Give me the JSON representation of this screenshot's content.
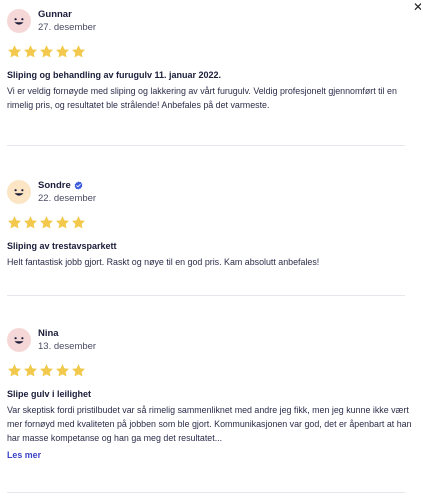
{
  "colors": {
    "star": "#f2c94c",
    "avatar_bg": "#f6d7d7",
    "avatar_bg_2": "#fbe5c5",
    "link": "#3b43c7",
    "verified": "#3b5bdb"
  },
  "close_icon": "close-icon",
  "reviews": [
    {
      "name": "Gunnar",
      "date": "27. desember",
      "rating": 5,
      "verified": false,
      "title": "Sliping og behandling av furugulv 11. januar 2022.",
      "text": "Vi er veldig fornøyde med sliping og lakkering av vårt furugulv. Veldig profesjonelt gjennomført til en rimelig pris, og resultatet ble strålende! Anbefales på det varmeste."
    },
    {
      "name": "Sondre",
      "date": "22. desember",
      "rating": 5,
      "verified": true,
      "title": "Sliping av trestavsparkett",
      "text": "Helt fantastisk jobb gjort. Raskt og nøye til en god pris. Kam absolutt anbefales!"
    },
    {
      "name": "Nina",
      "date": "13. desember",
      "rating": 5,
      "verified": false,
      "title": "Slipe gulv i leilighet",
      "text": "Var skeptisk fordi pristilbudet var så rimelig sammenliknet med andre jeg fikk, men jeg kunne ikke vært mer fornøyd med kvaliteten på jobben som ble gjort. Kommunikasjonen var god, det er åpenbart at han har masse kompetanse og han ga meg det resultatet...",
      "more_label": "Les mer"
    }
  ]
}
